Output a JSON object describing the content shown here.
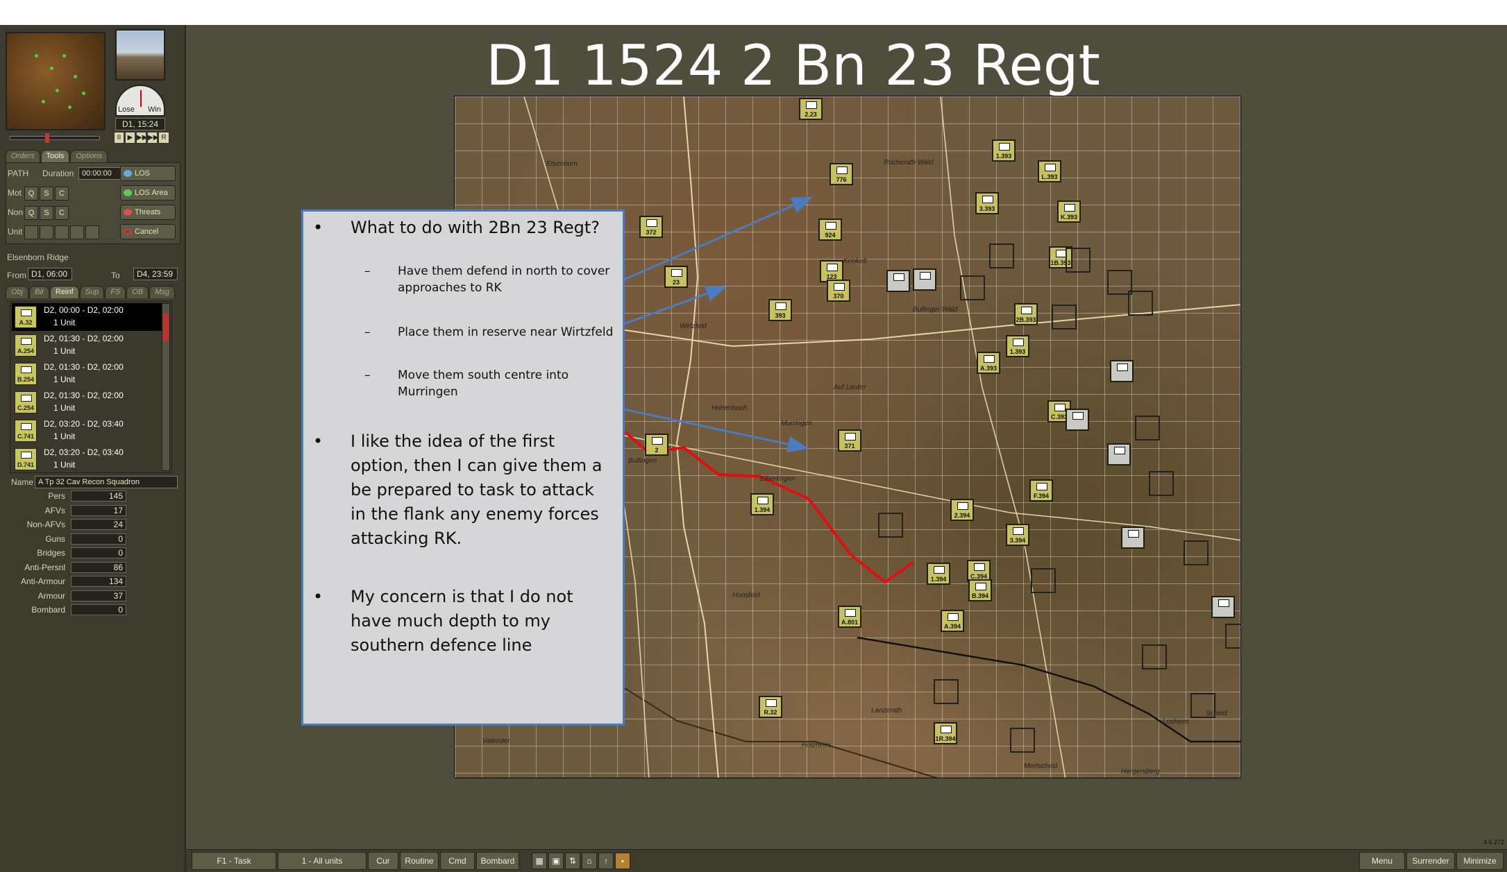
{
  "title": "D1 1524 2 Bn 23 Regt",
  "panel": {
    "time": "D1, 15:24",
    "gauge_lose": "Lose",
    "gauge_win": "Win",
    "playback": [
      "II",
      "▶",
      "▶▶",
      "▶▶▶",
      "R"
    ],
    "tabs_top": [
      "Orders",
      "Tools",
      "Options"
    ],
    "path_label": "PATH",
    "duration_label": "Duration",
    "duration_value": "00:00:00",
    "mot_label": "Mot",
    "non_label": "Non",
    "unit_label": "Unit",
    "qsc": [
      "Q",
      "S",
      "C"
    ],
    "los": "LOS",
    "los_area": "LOS Area",
    "threats": "Threats",
    "cancel": "Cancel",
    "location": "Elsenborn Ridge",
    "from_label": "From",
    "from_value": "D1, 06:00",
    "to_label": "To",
    "to_value": "D4, 23:59",
    "tabs_mid": [
      "Obj",
      "Bit",
      "Reinf",
      "Sup",
      "FS",
      "OB",
      "Msg"
    ],
    "reinforcements": [
      {
        "code": "A.32",
        "time": "D2, 00:00 - D2, 02:00",
        "count": "1 Unit",
        "selected": true
      },
      {
        "code": "A.254",
        "time": "D2, 01:30 - D2, 02:00",
        "count": "1 Unit",
        "selected": false
      },
      {
        "code": "B.254",
        "time": "D2, 01:30 - D2, 02:00",
        "count": "1 Unit",
        "selected": false
      },
      {
        "code": "C.254",
        "time": "D2, 01:30 - D2, 02:00",
        "count": "1 Unit",
        "selected": false
      },
      {
        "code": "C.741",
        "time": "D2, 03:20 - D2, 03:40",
        "count": "1 Unit",
        "selected": false
      },
      {
        "code": "D.741",
        "time": "D2, 03:20 - D2, 03:40",
        "count": "1 Unit",
        "selected": false
      }
    ],
    "name_label": "Name",
    "name_value": "A Tp 32 Cav Recon Squadron",
    "stats": [
      {
        "label": "Pers",
        "value": "145"
      },
      {
        "label": "AFVs",
        "value": "17"
      },
      {
        "label": "Non-AFVs",
        "value": "24"
      },
      {
        "label": "Guns",
        "value": "0"
      },
      {
        "label": "Bridges",
        "value": "0"
      },
      {
        "label": "Anti-Persnl",
        "value": "86"
      },
      {
        "label": "Anti-Armour",
        "value": "134"
      },
      {
        "label": "Armour",
        "value": "37"
      },
      {
        "label": "Bombard",
        "value": "0"
      }
    ]
  },
  "note": {
    "bullets": [
      {
        "type": "main",
        "text": "What to do with 2Bn 23 Regt?"
      },
      {
        "type": "sub",
        "text": "Have them defend in north to cover approaches to RK"
      },
      {
        "type": "sub",
        "text": "Place them in reserve near Wirtzfeld"
      },
      {
        "type": "sub",
        "text": "Move them south centre into Murringen"
      },
      {
        "type": "main",
        "text": "I like the idea of the first option, then I can give them a be prepared to task to attack in the flank any enemy forces attacking RK."
      },
      {
        "type": "main",
        "text": "My concern is that I do not have much depth to my southern defence line"
      }
    ]
  },
  "map": {
    "units": [
      {
        "code": "2.23"
      },
      {
        "code": "776"
      },
      {
        "code": "1.393"
      },
      {
        "code": "L.393"
      },
      {
        "code": "372"
      },
      {
        "code": "924"
      },
      {
        "code": "3.393"
      },
      {
        "code": "K.393"
      },
      {
        "code": "23"
      },
      {
        "code": "123"
      },
      {
        "code": "393"
      },
      {
        "code": "370"
      },
      {
        "code": "1B.393"
      },
      {
        "code": "2B.393"
      },
      {
        "code": "A.393"
      },
      {
        "code": "1.393"
      },
      {
        "code": "2"
      },
      {
        "code": "371"
      },
      {
        "code": "C.393"
      },
      {
        "code": "1.394"
      },
      {
        "code": "2.394"
      },
      {
        "code": "F.394"
      },
      {
        "code": "3.394"
      },
      {
        "code": "C.394"
      },
      {
        "code": "1.394"
      },
      {
        "code": "B.394"
      },
      {
        "code": "A.801"
      },
      {
        "code": "A.394"
      },
      {
        "code": "R.32"
      },
      {
        "code": "1R.394"
      }
    ],
    "places": [
      "Elsenborn",
      "Rocherath Wald",
      "Wirtzfeld",
      "Bullinger Wald",
      "Murringen",
      "Hohenbach",
      "Bullingen",
      "Auf Leuter",
      "Eibertingen",
      "Honsfeld",
      "Lanzerath",
      "Holzheim",
      "Valender",
      "Hergersberg",
      "Scheid",
      "Krinkelt",
      "Losheim",
      "Merlscheid"
    ]
  },
  "bottom": {
    "buttons": [
      "F1 - Task",
      "1 - All units",
      "Cur",
      "Routine",
      "Cmd",
      "Bombard"
    ],
    "right_buttons": [
      "Menu",
      "Surrender",
      "Minimize"
    ],
    "version": "4.6.272"
  },
  "colors": {
    "note_border": "#4a7cc0",
    "arrow": "#4a7cc0",
    "route": "#e01010",
    "unit_us": "#c7c35a",
    "unit_de": "#c9c9c6"
  }
}
